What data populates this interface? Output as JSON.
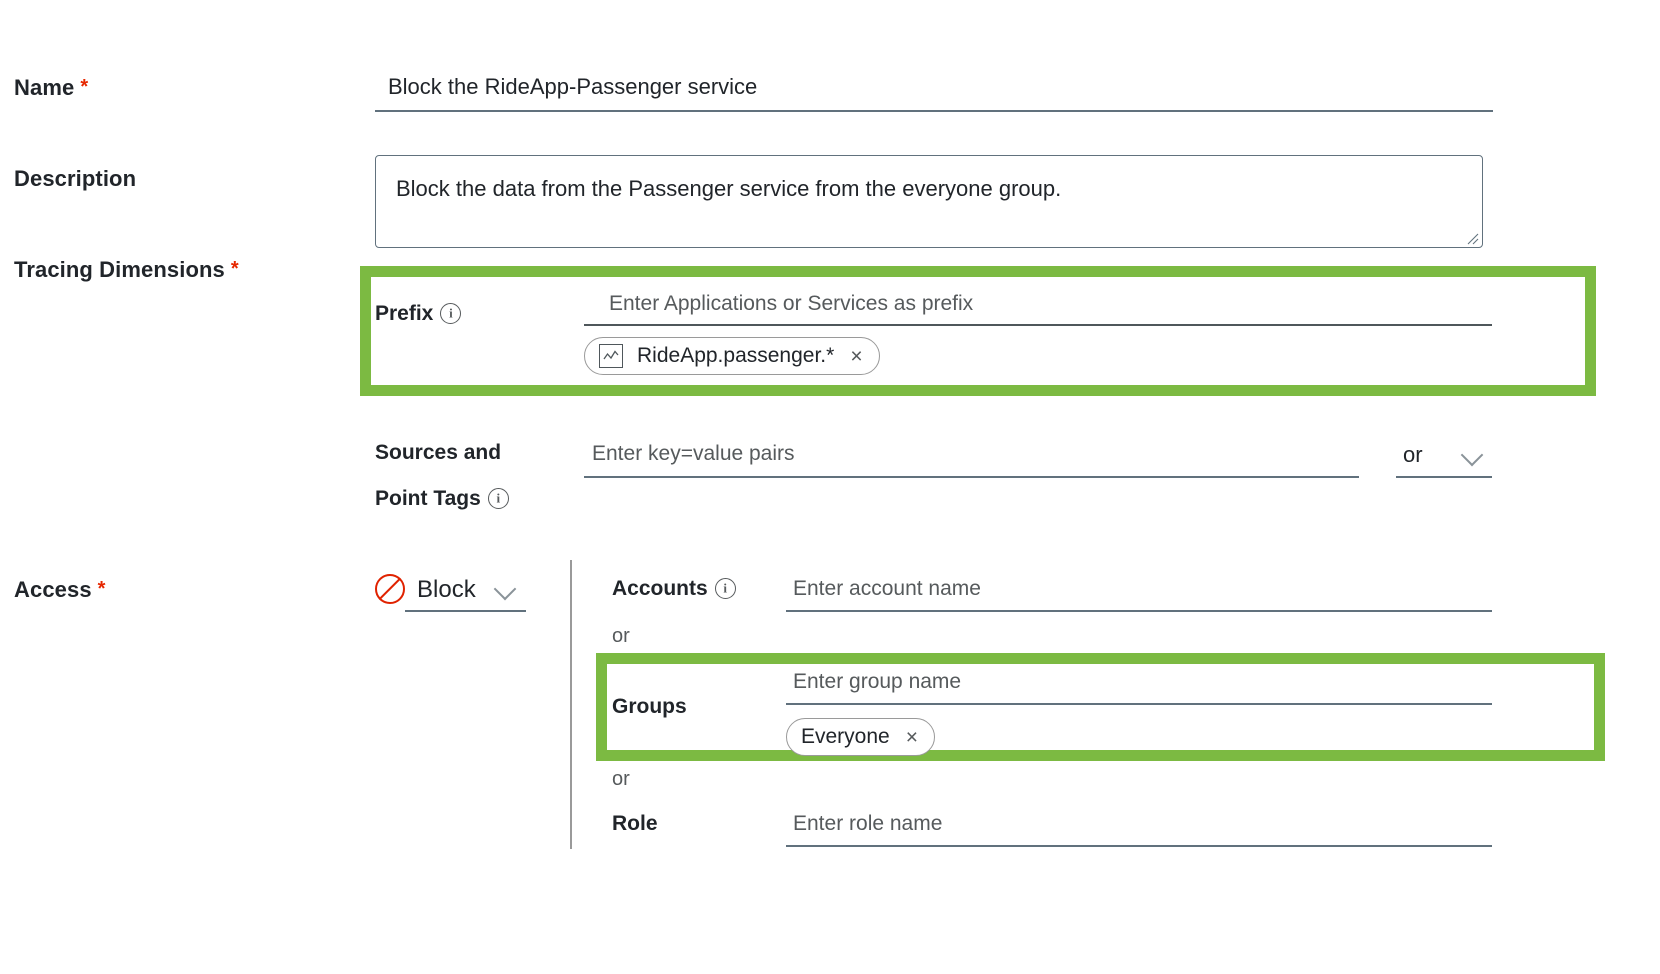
{
  "form": {
    "fields": {
      "name": {
        "label": "Name",
        "required_marker": "*",
        "value": "Block the RideApp-Passenger service"
      },
      "description": {
        "label": "Description",
        "value": "Block the data from the Passenger service from the everyone group."
      },
      "tracing_dimensions": {
        "label": "Tracing Dimensions",
        "required_marker": "*",
        "prefix": {
          "label": "Prefix",
          "info_icon": "info-icon",
          "placeholder": "Enter Applications or Services as prefix",
          "chips": [
            {
              "icon": "metric-chart-icon",
              "label": "RideApp.passenger.*",
              "close": "×"
            }
          ]
        },
        "sources_and_point_tags": {
          "label_line1": "Sources and",
          "label_line2": "Point Tags",
          "info_icon": "info-icon",
          "placeholder": "Enter key=value pairs",
          "operator": {
            "value": "or",
            "chevron": "chevron-down-icon"
          }
        }
      },
      "access": {
        "label": "Access",
        "required_marker": "*",
        "permission_select": {
          "icon": "block-prohibition-icon",
          "value": "Block",
          "chevron": "chevron-down-icon"
        },
        "accounts": {
          "label": "Accounts",
          "info_icon": "info-icon",
          "placeholder": "Enter account name"
        },
        "separator_1": "or",
        "groups": {
          "label": "Groups",
          "placeholder": "Enter group name",
          "chips": [
            {
              "label": "Everyone",
              "close": "×"
            }
          ]
        },
        "separator_2": "or",
        "role": {
          "label": "Role",
          "placeholder": "Enter role name"
        }
      }
    }
  },
  "colors": {
    "highlight_green": "#7cba42",
    "required_red": "#e62700",
    "block_red": "#e02200",
    "underline_gray": "#61717d",
    "placeholder_gray": "#565a5c",
    "text_dark": "#21252a"
  }
}
